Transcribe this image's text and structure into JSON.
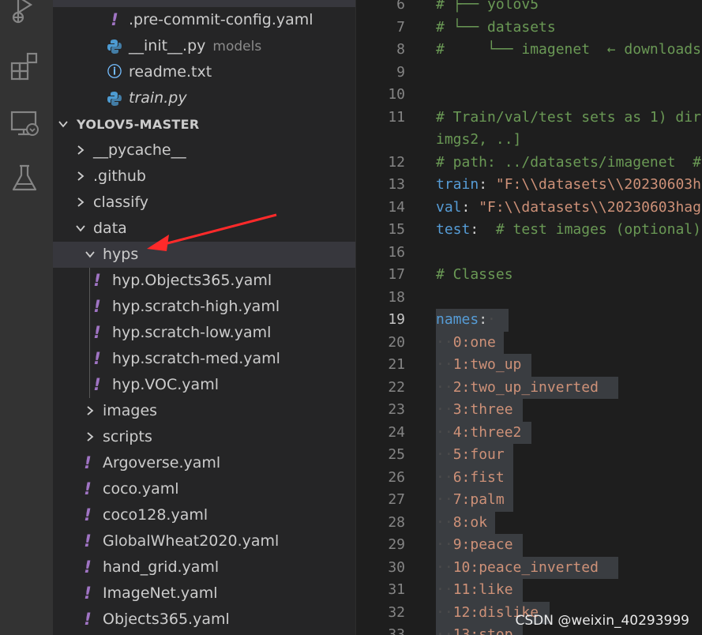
{
  "activity_bar": {
    "icons": [
      "run-debug-icon",
      "extensions-icon",
      "remote-explorer-icon",
      "testing-icon"
    ]
  },
  "explorer": {
    "top_items": [
      {
        "name": ".pre-commit-config.yaml",
        "icon": "yaml-icon"
      },
      {
        "name": "__init__.py",
        "icon": "python-icon",
        "description": "models"
      },
      {
        "name": "readme.txt",
        "icon": "info-icon"
      },
      {
        "name": "train.py",
        "icon": "python-icon",
        "italic": true
      }
    ],
    "section_title": "YOLOV5-MASTER",
    "folders": {
      "pycache": "__pycache__",
      "github": ".github",
      "classify": "classify",
      "data": "data",
      "hyps": "hyps",
      "images": "images",
      "scripts": "scripts"
    },
    "hyps_files": [
      "hyp.Objects365.yaml",
      "hyp.scratch-high.yaml",
      "hyp.scratch-low.yaml",
      "hyp.scratch-med.yaml",
      "hyp.VOC.yaml"
    ],
    "data_files": [
      "Argoverse.yaml",
      "coco.yaml",
      "coco128.yaml",
      "GlobalWheat2020.yaml",
      "hand_grid.yaml",
      "ImageNet.yaml",
      "Objects365.yaml"
    ],
    "yaml_glyph": "!",
    "info_glyph": "ⓘ"
  },
  "editor": {
    "active_line": "19",
    "lines": [
      {
        "n": "6",
        "parts": [
          {
            "t": "# ├── yolov5",
            "c": "c-comment"
          }
        ]
      },
      {
        "n": "7",
        "parts": [
          {
            "t": "# └── datasets",
            "c": "c-comment"
          }
        ]
      },
      {
        "n": "8",
        "parts": [
          {
            "t": "#     └── imagenet  ← downloads",
            "c": "c-comment"
          }
        ]
      },
      {
        "n": "9",
        "parts": []
      },
      {
        "n": "10",
        "parts": []
      },
      {
        "n": "11",
        "parts": [
          {
            "t": "# Train/val/test sets as 1) dir:",
            "c": "c-comment"
          }
        ]
      },
      {
        "n": "",
        "parts": [
          {
            "t": "imgs2, ..]",
            "c": "c-comment"
          }
        ]
      },
      {
        "n": "12",
        "parts": [
          {
            "t": "# path: ../datasets/imagenet  #",
            "c": "c-comment"
          }
        ]
      },
      {
        "n": "13",
        "parts": [
          {
            "t": "train",
            "c": "c-key"
          },
          {
            "t": ": ",
            "c": "c-plain"
          },
          {
            "t": "\"F:\\\\datasets\\\\20230603h",
            "c": "c-str"
          }
        ]
      },
      {
        "n": "14",
        "parts": [
          {
            "t": "val",
            "c": "c-key"
          },
          {
            "t": ": ",
            "c": "c-plain"
          },
          {
            "t": "\"F:\\\\datasets\\\\20230603hag",
            "c": "c-str"
          }
        ]
      },
      {
        "n": "15",
        "parts": [
          {
            "t": "test",
            "c": "c-key"
          },
          {
            "t": ":  ",
            "c": "c-plain"
          },
          {
            "t": "# test images (optional)",
            "c": "c-comment"
          }
        ]
      },
      {
        "n": "16",
        "parts": []
      },
      {
        "n": "17",
        "parts": [
          {
            "t": "# Classes",
            "c": "c-comment"
          }
        ]
      },
      {
        "n": "18",
        "parts": []
      },
      {
        "n": "19",
        "parts": [
          {
            "t": "names",
            "c": "c-key"
          },
          {
            "t": ":",
            "c": "c-plain"
          },
          {
            "t": "·",
            "c": "ws"
          }
        ],
        "sel": 92
      },
      {
        "n": "20",
        "parts": [
          {
            "t": "··",
            "c": "ws"
          },
          {
            "t": "0:one",
            "c": "c-str"
          }
        ],
        "sel": 86
      },
      {
        "n": "21",
        "parts": [
          {
            "t": "··",
            "c": "ws"
          },
          {
            "t": "1:two_up",
            "c": "c-str"
          }
        ],
        "sel": 121
      },
      {
        "n": "22",
        "parts": [
          {
            "t": "··",
            "c": "ws"
          },
          {
            "t": "2:two_up_inverted",
            "c": "c-str"
          }
        ],
        "sel": 231
      },
      {
        "n": "23",
        "parts": [
          {
            "t": "··",
            "c": "ws"
          },
          {
            "t": "3:three",
            "c": "c-str"
          }
        ],
        "sel": 110
      },
      {
        "n": "24",
        "parts": [
          {
            "t": "··",
            "c": "ws"
          },
          {
            "t": "4:three2",
            "c": "c-str"
          }
        ],
        "sel": 121
      },
      {
        "n": "25",
        "parts": [
          {
            "t": "··",
            "c": "ws"
          },
          {
            "t": "5:four",
            "c": "c-str"
          }
        ],
        "sel": 98
      },
      {
        "n": "26",
        "parts": [
          {
            "t": "··",
            "c": "ws"
          },
          {
            "t": "6:fist",
            "c": "c-str"
          }
        ],
        "sel": 98
      },
      {
        "n": "27",
        "parts": [
          {
            "t": "··",
            "c": "ws"
          },
          {
            "t": "7:palm",
            "c": "c-str"
          }
        ],
        "sel": 98
      },
      {
        "n": "28",
        "parts": [
          {
            "t": "··",
            "c": "ws"
          },
          {
            "t": "8:ok",
            "c": "c-str"
          }
        ],
        "sel": 75
      },
      {
        "n": "29",
        "parts": [
          {
            "t": "··",
            "c": "ws"
          },
          {
            "t": "9:peace",
            "c": "c-str"
          }
        ],
        "sel": 110
      },
      {
        "n": "30",
        "parts": [
          {
            "t": "··",
            "c": "ws"
          },
          {
            "t": "10:peace_inverted",
            "c": "c-str"
          }
        ],
        "sel": 231
      },
      {
        "n": "31",
        "parts": [
          {
            "t": "··",
            "c": "ws"
          },
          {
            "t": "11:like",
            "c": "c-str"
          }
        ],
        "sel": 110
      },
      {
        "n": "32",
        "parts": [
          {
            "t": "··",
            "c": "ws"
          },
          {
            "t": "12:dislike",
            "c": "c-str"
          }
        ],
        "sel": 144
      },
      {
        "n": "33",
        "parts": [
          {
            "t": "··",
            "c": "ws"
          },
          {
            "t": "13:stop",
            "c": "c-str"
          }
        ],
        "sel": 110
      }
    ]
  },
  "watermark": "CSDN @weixin_40293999"
}
